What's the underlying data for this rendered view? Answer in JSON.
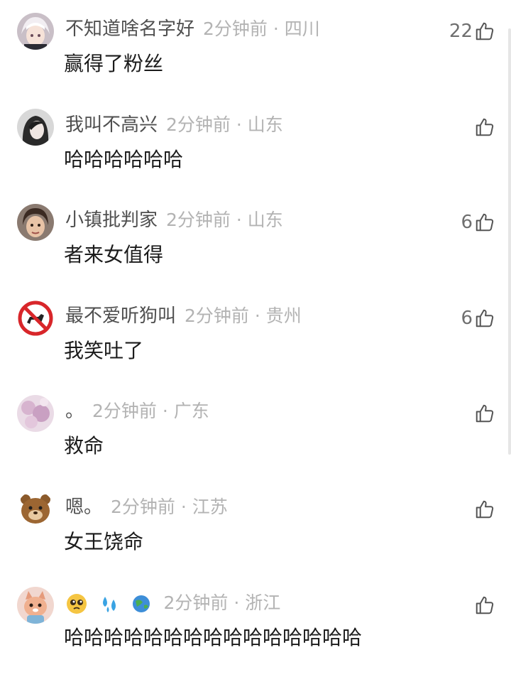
{
  "colors": {
    "username": "#4f4f4f",
    "meta": "#b3b3b3",
    "text": "#1b1b1b",
    "like": "#6f6f6f",
    "background": "#ffffff"
  },
  "comments": [
    {
      "username": "不知道啥名字好",
      "time": "2分钟前",
      "separator": "·",
      "location": "四川",
      "text": "赢得了粉丝",
      "likes": "22",
      "avatar_icon": "anime-avatar-icon"
    },
    {
      "username": "我叫不高兴",
      "time": "2分钟前",
      "separator": "·",
      "location": "山东",
      "text": "哈哈哈哈哈哈",
      "likes": "",
      "avatar_icon": "girl-avatar-icon"
    },
    {
      "username": "小镇批判家",
      "time": "2分钟前",
      "separator": "·",
      "location": "山东",
      "text": "者来女值得",
      "likes": "6",
      "avatar_icon": "child-avatar-icon"
    },
    {
      "username": "最不爱听狗叫",
      "time": "2分钟前",
      "separator": "·",
      "location": "贵州",
      "text": "我笑吐了",
      "likes": "6",
      "avatar_icon": "no-dog-sign-avatar-icon"
    },
    {
      "username": "。",
      "time": "2分钟前",
      "separator": "·",
      "location": "广东",
      "text": "救命",
      "likes": "",
      "avatar_icon": "flower-avatar-icon"
    },
    {
      "username": "嗯。",
      "time": "2分钟前",
      "separator": "·",
      "location": "江苏",
      "text": "女王饶命",
      "likes": "",
      "avatar_icon": "bear-avatar-icon"
    },
    {
      "username_emojis": [
        "pleading-face-emoji",
        "sweat-droplets-emoji",
        "globe-emoji"
      ],
      "time": "2分钟前",
      "separator": "·",
      "location": "浙江",
      "text": "哈哈哈哈哈哈哈哈哈哈哈哈哈哈哈",
      "likes": "",
      "avatar_icon": "cat-avatar-icon"
    }
  ]
}
